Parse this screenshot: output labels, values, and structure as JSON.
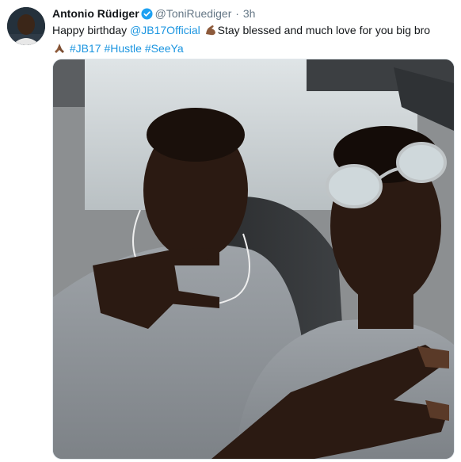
{
  "tweet": {
    "author_name": "Antonio Rüdiger",
    "handle": "@ToniRuediger",
    "separator": "·",
    "timestamp": "3h",
    "text": {
      "prefix": "Happy birthday",
      "mention": "@JB17Official",
      "body": "Stay blessed and much love for you big bro",
      "hashtags": [
        "#JB17",
        "#Hustle",
        "#SeeYa"
      ]
    },
    "icons": {
      "verified": "verified-badge-icon",
      "emoji_1": "flexed-biceps-emoji",
      "emoji_2": "folded-hands-emoji"
    },
    "colors": {
      "link": "#1b95e0",
      "meta": "#657786",
      "text": "#14171a"
    }
  }
}
